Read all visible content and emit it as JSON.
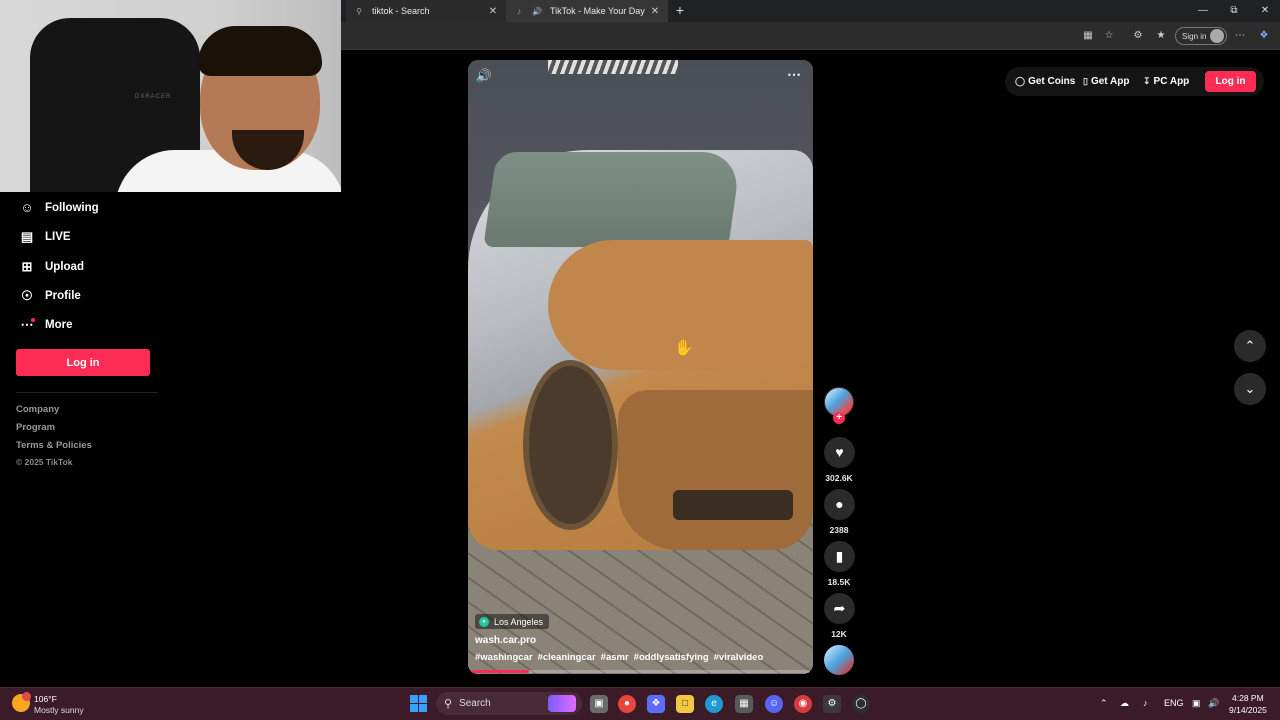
{
  "browser": {
    "tabs": [
      {
        "title": "tiktok - Search",
        "icon": "search-icon"
      },
      {
        "title": "TikTok - Make Your Day",
        "icon": "tiktok-icon"
      }
    ],
    "new_tab_glyph": "+",
    "signin_label": "Sign in"
  },
  "webcam": {
    "chair_text": "DXRACER"
  },
  "sidebar": {
    "items": [
      {
        "label": "Following",
        "icon": "following-icon"
      },
      {
        "label": "LIVE",
        "icon": "live-icon"
      },
      {
        "label": "Upload",
        "icon": "upload-icon"
      },
      {
        "label": "Profile",
        "icon": "profile-icon"
      },
      {
        "label": "More",
        "icon": "more-icon"
      }
    ],
    "login_label": "Log in",
    "footer_links": [
      "Company",
      "Program",
      "Terms & Policies"
    ],
    "copyright": "© 2025 TikTok"
  },
  "video": {
    "location": "Los Angeles",
    "author": "wash.car.pro",
    "hashtags": [
      "#washingcar",
      "#cleaningcar",
      "#asmr",
      "#oddlysatisfying",
      "#viralvideo"
    ],
    "progress": 0.17
  },
  "actions": {
    "likes": "302.6K",
    "comments": "2388",
    "saves": "18.5K",
    "shares": "12K"
  },
  "header": {
    "get_coins": "Get Coins",
    "get_app": "Get App",
    "pc_app": "PC App",
    "login_label": "Log in"
  },
  "taskbar": {
    "temperature": "106°F",
    "weather": "Mostly sunny",
    "search_label": "Search",
    "language": "ENG",
    "time": "4:28 PM",
    "date": "9/14/2025"
  },
  "colors": {
    "accent": "#fe2c55",
    "taskbar": "#3a1b27"
  }
}
